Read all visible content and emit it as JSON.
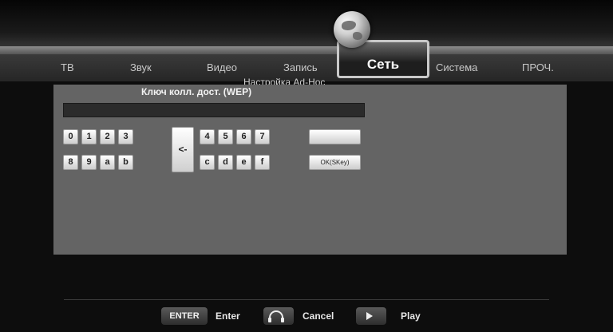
{
  "tabs": [
    {
      "label": "ТВ"
    },
    {
      "label": "Звук"
    },
    {
      "label": "Видео"
    },
    {
      "label": "Запись"
    },
    {
      "label": "Сеть"
    },
    {
      "label": "Система"
    },
    {
      "label": "ПРОЧ."
    }
  ],
  "active_tab": "Сеть",
  "subtitle": "Настройка Ad-Hoc",
  "dialog": {
    "title": "Ключ колл. дост. (WEP)",
    "key_value": "",
    "keys_row1": [
      "0",
      "1",
      "2",
      "3",
      "4",
      "5",
      "6",
      "7"
    ],
    "keys_row2": [
      "8",
      "9",
      "a",
      "b",
      "c",
      "d",
      "e",
      "f"
    ],
    "backspace_label": "<-",
    "ok_label": "OK(SKey)"
  },
  "footer": {
    "enter_key": "ENTER",
    "enter_label": "Enter",
    "cancel_label": "Cancel",
    "play_label": "Play"
  },
  "icons": {
    "network": "globe-icon",
    "cancel": "headphone-icon",
    "play": "play-icon"
  }
}
